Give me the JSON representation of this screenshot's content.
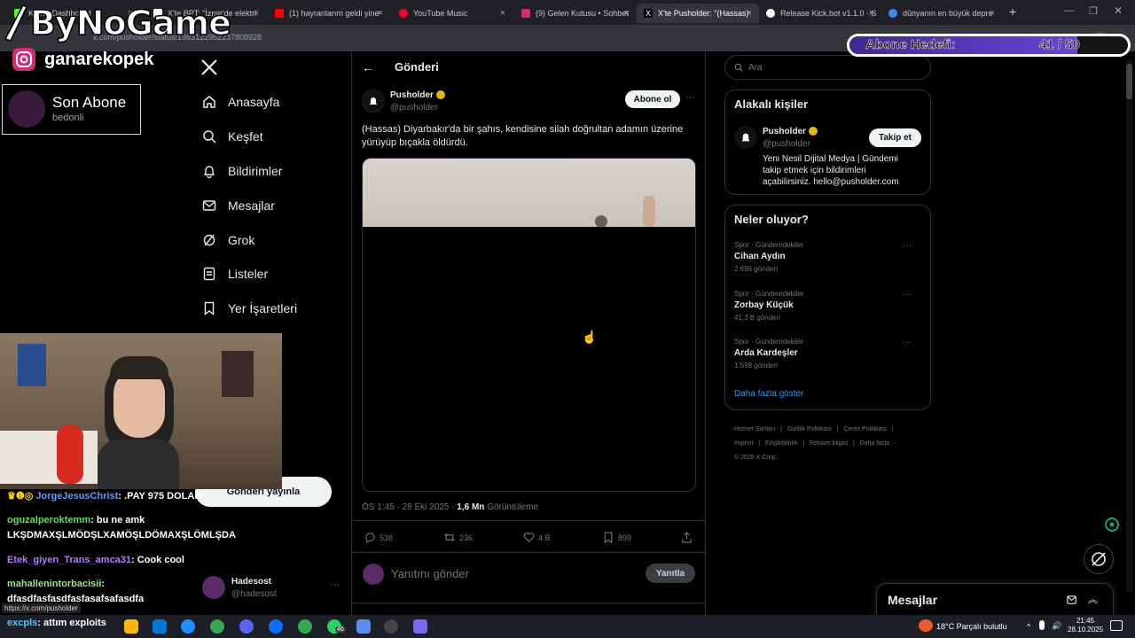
{
  "browser": {
    "tabs": [
      {
        "title": "Kam - Dashboard",
        "color": "#53fc18"
      },
      {
        "title": "X'te BPT: \"İzmir'de elektri",
        "color": "#ffffff"
      },
      {
        "title": "(1) hayranlarım geldi yine",
        "color": "#ff0000"
      },
      {
        "title": "YouTube Music",
        "color": "#ff0033"
      },
      {
        "title": "(9) Gelen Kutusu • Sohbet",
        "color": "#d62976"
      },
      {
        "title": "X'te Pusholder: \"(Hassas)",
        "color": "#ffffff"
      },
      {
        "title": "Release Kick.bot v1.1.0 · S",
        "color": "#ffffff"
      },
      {
        "title": "dünyanın en büyük depre",
        "color": "#4285f4"
      }
    ],
    "url": "x.com/pusholder/status/1983122962237808928",
    "status_url": "https://x.com/pusholder"
  },
  "overlay": {
    "logo": "ByNoGame",
    "instagram": "ganarekopek",
    "sub_title": "Son Abone",
    "sub_name": "bedonli",
    "goal_label": "Abone Hedefi:",
    "goal_value": "41 / 50",
    "goal_fraction": 0.82
  },
  "nav": {
    "items": [
      {
        "label": "Anasayfa",
        "icon": "home-icon"
      },
      {
        "label": "Keşfet",
        "icon": "search-icon"
      },
      {
        "label": "Bildirimler",
        "icon": "bell-icon"
      },
      {
        "label": "Mesajlar",
        "icon": "mail-icon"
      },
      {
        "label": "Grok",
        "icon": "grok-icon"
      },
      {
        "label": "Listeler",
        "icon": "list-icon"
      },
      {
        "label": "Yer İşaretleri",
        "icon": "bookmark-icon"
      }
    ],
    "post_button": "Gönderi yayınla",
    "account_name": "Hadesost",
    "account_handle": "@hadesost"
  },
  "post": {
    "header": "Gönderi",
    "author": "Pusholder",
    "handle": "@pusholder",
    "follow": "Abone ol",
    "text": "(Hassas) Diyarbakır'da bir şahıs, kendisine silah doğrultan adamın üzerine yürüyüp bıçakla öldürdü.",
    "time": "ÖS 1:45 · 28 Eki 2025 · ",
    "views": "1,6 Mn",
    "views_label": "Görüntüleme",
    "replies": "538",
    "reposts": "236",
    "likes": "4 B",
    "bookmarks": "899",
    "reply_placeholder": "Yanıtını gönder",
    "reply_button": "Yanıtla"
  },
  "sidebar": {
    "search_placeholder": "Ara",
    "related_title": "Alakalı kişiler",
    "related_name": "Pusholder",
    "related_handle": "@pusholder",
    "related_follow": "Takip et",
    "related_bio_1": "Yeni Nesil Dijital Medya | Gündemi",
    "related_bio_2": "takip etmek için bildirimleri",
    "related_bio_3": "açabilirsiniz. hello@pusholder.com",
    "trends_title": "Neler oluyor?",
    "trends": [
      {
        "category": "Spor · Gündemdekiler",
        "name": "Cihan Aydın",
        "count": "2.696 gönderi"
      },
      {
        "category": "Spor · Gündemdekiler",
        "name": "Zorbay Küçük",
        "count": "41,3 B gönderi"
      },
      {
        "category": "Spor · Gündemdekiler",
        "name": "Arda Kardeşler",
        "count": "1.598 gönderi"
      }
    ],
    "show_more": "Daha fazla göster",
    "footer_1": "Hizmet Şartları   |   Gizlilik Politikası   |   Çerez Politikası   |",
    "footer_2": "Imprint   |   Erişilebilirlik   |   Reklam bilgisi   |   Daha fazla ···",
    "footer_3": "© 2025 X Corp.",
    "messages": "Mesajlar"
  },
  "chat": [
    {
      "user": "JorgeJesusChrist",
      "msg": ": .PAY 975 DOLAR",
      "color": "#5b9cff"
    },
    {
      "user": "oguzalperoktemm",
      "msg": ": bu ne amk",
      "color": "#57e35a"
    },
    {
      "user": "",
      "msg": "LKŞDMAXŞLMÖDŞLXAMÖŞLDÖMAXŞLÖMLŞDA",
      "color": "#ffffff"
    },
    {
      "user": "Etek_giyen_Trans_amca31",
      "msg": ": Cook cool",
      "color": "#b57cff"
    },
    {
      "user": "mahallenintorbacisii",
      "msg": ":",
      "color": "#9ee27f"
    },
    {
      "user": "",
      "msg": "dfasdfasfasdfasfasafsafasdfa",
      "color": "#ffffff"
    },
    {
      "user": "excpls",
      "msg": ": attım exploits",
      "color": "#57c9ff"
    }
  ],
  "taskbar": {
    "weather": "18°C  Parçalı bulutlu",
    "time": "21:45",
    "date": "28.10.2025",
    "badge": "46"
  }
}
